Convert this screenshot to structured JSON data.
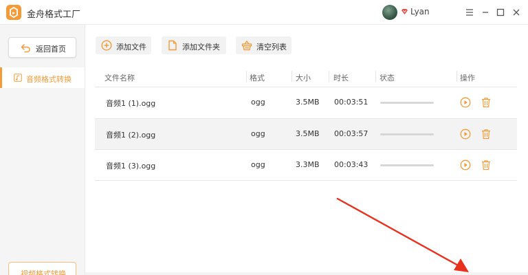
{
  "app": {
    "title": "金舟格式工厂",
    "username": "Lyan",
    "brand_color": "#f29b38"
  },
  "window_controls": [
    {
      "name": "menu-icon"
    },
    {
      "name": "minimize-icon"
    },
    {
      "name": "maximize-icon"
    },
    {
      "name": "close-icon"
    }
  ],
  "sidebar": {
    "home_label": "返回首页",
    "active_item": "音频格式转换",
    "bottom_button": "视频格式转换"
  },
  "toolbar": {
    "add_file": "添加文件",
    "add_folder": "添加文件夹",
    "clear_list": "清空列表"
  },
  "table": {
    "headers": {
      "name": "文件名称",
      "format": "格式",
      "size": "大小",
      "duration": "时长",
      "status": "状态",
      "actions": "操作"
    },
    "rows": [
      {
        "name": "音频1 (1).ogg",
        "format": "ogg",
        "size": "3.5MB",
        "duration": "00:03:51",
        "progress": 0
      },
      {
        "name": "音频1 (2).ogg",
        "format": "ogg",
        "size": "3.5MB",
        "duration": "00:03:57",
        "progress": 0
      },
      {
        "name": "音频1 (3).ogg",
        "format": "ogg",
        "size": "3.3MB",
        "duration": "00:03:43",
        "progress": 0
      }
    ]
  }
}
